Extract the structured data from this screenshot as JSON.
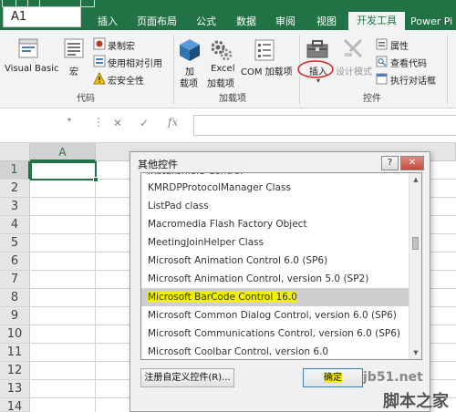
{
  "tabs": [
    {
      "label": "文件"
    },
    {
      "label": "开始"
    },
    {
      "label": "插入"
    },
    {
      "label": "页面布局"
    },
    {
      "label": "公式"
    },
    {
      "label": "数据"
    },
    {
      "label": "审阅"
    },
    {
      "label": "视图"
    },
    {
      "label": "开发工具"
    },
    {
      "label": "Power Pi"
    }
  ],
  "ribbon": {
    "code_group": {
      "visual_basic": "Visual Basic",
      "macros": "宏",
      "record_macro": "录制宏",
      "relative_refs": "使用相对引用",
      "macro_security": "宏安全性",
      "label": "代码"
    },
    "addins_group": {
      "addins_line1": "加",
      "addins_line2": "载项",
      "excel_line1": "Excel",
      "excel_line2": "加载项",
      "com_addins": "COM 加载项",
      "label": "加载项"
    },
    "controls_group": {
      "insert": "插入",
      "design_mode": "设计模式",
      "properties": "属性",
      "view_code": "查看代码",
      "run_dialog": "执行对话框",
      "label": "控件"
    }
  },
  "formula_bar": {
    "name_box": "A1",
    "cancel_symbol": "✕",
    "enter_symbol": "✓",
    "fx_symbol": "fx"
  },
  "sheet": {
    "columns": [
      "A"
    ],
    "rows": [
      "1",
      "2",
      "3",
      "4",
      "5",
      "6",
      "7",
      "8",
      "9",
      "10",
      "11",
      "12",
      "13",
      "14"
    ]
  },
  "dialog": {
    "title": "其他控件",
    "help_button": "?",
    "close_button": "✕",
    "items": [
      "Installshield Control",
      "KMRDPProtocolManager  Class",
      "ListPad class",
      "Macromedia Flash Factory Object",
      "MeetingJoinHelper Class",
      "Microsoft Animation Control 6.0 (SP6)",
      "Microsoft Animation Control, version 5.0 (SP2)",
      "Microsoft BarCode Control 16.0",
      "Microsoft Common Dialog Control, version 6.0 (SP6)",
      "Microsoft Communications Control, version 6.0 (SP6)",
      "Microsoft Coolbar Control, version 6.0"
    ],
    "selected_item": "Microsoft BarCode Control 16.0",
    "register_button": "注册自定义控件(R)...",
    "ok_button": "确定"
  },
  "watermark": {
    "site": "jb51.net",
    "brand": "脚本之家"
  }
}
